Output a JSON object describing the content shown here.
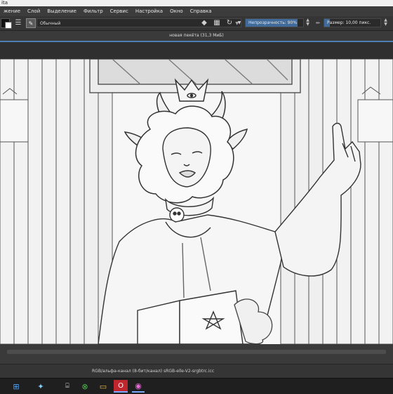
{
  "app": {
    "title_fragment": "ita"
  },
  "menu": [
    "жение",
    "Слой",
    "Выделение",
    "Фильтр",
    "Сервис",
    "Настройка",
    "Окно",
    "Справка"
  ],
  "toolbar": {
    "brush_preset": "Обычный",
    "opacity_label": "Непрозрачность: 90%",
    "opacity_value": 0.9,
    "size_label": "Размер: 10,00 пикс.",
    "size_value": 10,
    "foreground_color": "#111111",
    "background_color": "#ffffff"
  },
  "document": {
    "title": "новая пекёта (31,3 МиБ)"
  },
  "status": {
    "color_info": "RGB/альфа-канал (8-бит/канал)  sRGB-elle-V2-srgbtrc.icc"
  },
  "taskbar": {
    "icons": [
      "start-icon",
      "widgets-icon",
      "terminal-icon",
      "xbox-icon",
      "files-icon",
      "opera-icon",
      "paint-icon"
    ]
  },
  "theme": {
    "accent": "#4c7fb6",
    "dark_panel": "#353535"
  }
}
